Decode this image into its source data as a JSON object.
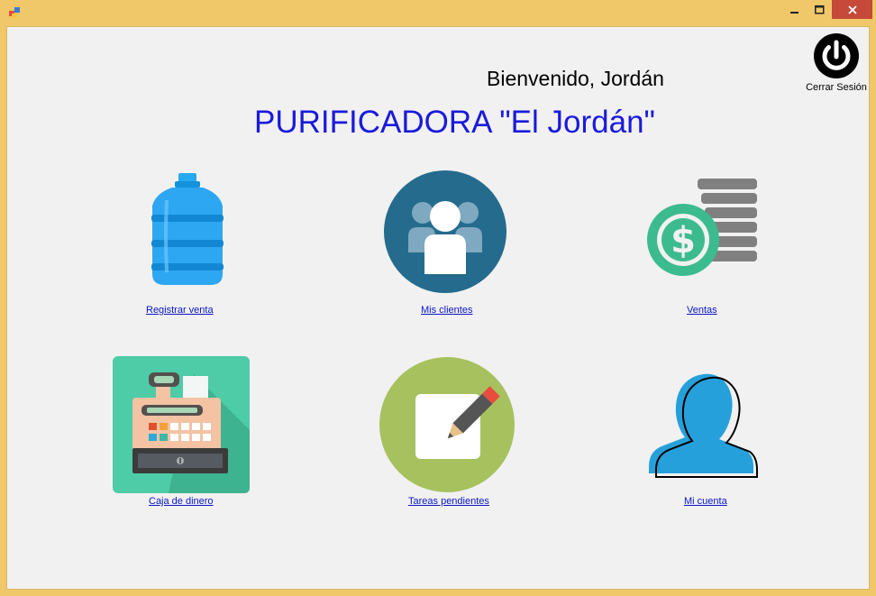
{
  "window": {
    "controls": {
      "minimize": "–",
      "maximize": "☐",
      "close": "✕"
    }
  },
  "header": {
    "welcome": "Bienvenido, Jordán",
    "brand": "PURIFICADORA \"El Jordán\"",
    "logout_label": "Cerrar Sesión",
    "logout_icon": "power-icon"
  },
  "tiles": [
    {
      "label": "Registrar venta",
      "icon": "water-jug-icon"
    },
    {
      "label": "Mis clientes",
      "icon": "users-icon"
    },
    {
      "label": "Ventas",
      "icon": "money-coins-icon"
    },
    {
      "label": "Caja de dinero",
      "icon": "cash-register-icon"
    },
    {
      "label": "Tareas pendientes",
      "icon": "notepad-pencil-icon"
    },
    {
      "label": "Mi cuenta",
      "icon": "user-silhouette-icon"
    }
  ],
  "colors": {
    "titlebar": "#f0c869",
    "client_bg": "#f1f1f1",
    "brand_text": "#1a1adc",
    "link_text": "#0b16c4",
    "close_button": "#c7493a"
  }
}
